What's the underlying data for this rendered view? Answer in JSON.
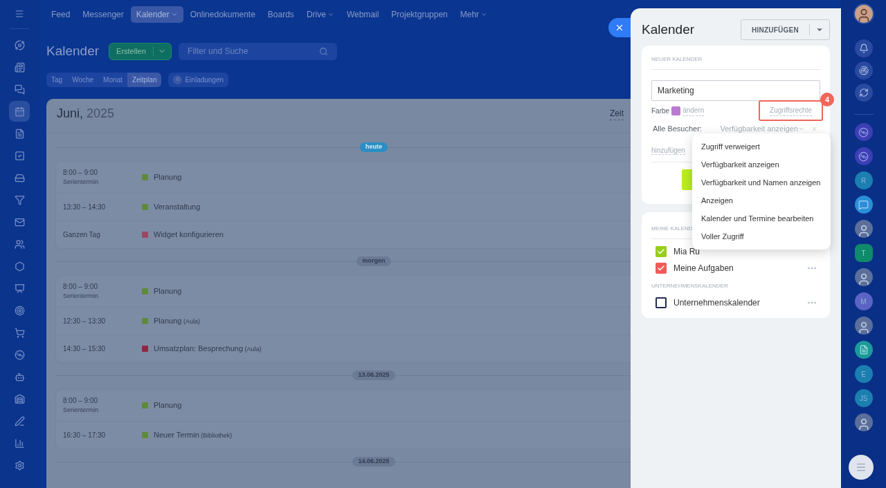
{
  "nav": {
    "items": [
      {
        "label": "Feed",
        "selected": false,
        "caret": false
      },
      {
        "label": "Messenger",
        "selected": false,
        "caret": false
      },
      {
        "label": "Kalender",
        "selected": true,
        "caret": true
      },
      {
        "label": "Onlinedokumente",
        "selected": false,
        "caret": false
      },
      {
        "label": "Boards",
        "selected": false,
        "caret": false
      },
      {
        "label": "Drive",
        "selected": false,
        "caret": true
      },
      {
        "label": "Webmail",
        "selected": false,
        "caret": false
      },
      {
        "label": "Projektgruppen",
        "selected": false,
        "caret": false
      },
      {
        "label": "Mehr",
        "selected": false,
        "caret": true
      }
    ]
  },
  "page": {
    "title": "Kalender",
    "create_button": "Erstellen",
    "search": {
      "placeholder": "Filter und Suche"
    },
    "view_tabs": [
      {
        "label": "Tag",
        "selected": false
      },
      {
        "label": "Woche",
        "selected": false
      },
      {
        "label": "Monat",
        "selected": false
      },
      {
        "label": "Zeitplan",
        "selected": true
      }
    ],
    "invitations": {
      "count": "0",
      "label": "Einladungen"
    }
  },
  "schedule": {
    "month": "Juni,",
    "year": "2025",
    "column_cut": "Zeit",
    "days": [
      {
        "label": "heute",
        "today": true,
        "events": [
          {
            "time": "8:00 – 9:00",
            "note": "Serientermin",
            "title": "Planung",
            "color": "#5e8a3c"
          },
          {
            "time": "13:30 – 14:30",
            "title": "Veranstaltung",
            "color": "#5e8a3c"
          },
          {
            "time": "Ganzen Tag",
            "title": "Widget konfigurieren",
            "color": "#9a4a60"
          }
        ]
      },
      {
        "label": "morgen",
        "today": false,
        "events": [
          {
            "time": "8:00 – 9:00",
            "note": "Serientermin",
            "title": "Planung",
            "color": "#5e8a3c"
          },
          {
            "time": "12:30 – 13:30",
            "title": "Planung",
            "location": "(Aula)",
            "color": "#5e8a3c"
          },
          {
            "time": "14:30 – 15:30",
            "title": "Umsatzplan: Besprechung",
            "location": "(Aula)",
            "color": "#8a2a40"
          }
        ]
      },
      {
        "label": "13.06.2025",
        "today": false,
        "events": [
          {
            "time": "8:00 – 9:00",
            "note": "Serientermin",
            "title": "Planung",
            "color": "#5e8a3c"
          },
          {
            "time": "16:30 – 17:30",
            "title": "Neuer Termin",
            "location": "(Bibliothek)",
            "color": "#5e8a3c"
          }
        ]
      },
      {
        "label": "14.06.2025",
        "today": false
      }
    ]
  },
  "panel": {
    "title": "Kalender",
    "add_button": "HINZUFÜGEN",
    "new_calendar": {
      "section_label": "NEUER KALENDER",
      "name_value": "Marketing",
      "color_label": "Farbe",
      "color": "#b97ad0",
      "change_link": "ändern",
      "access_link": "Zugriffsrechte",
      "step_badge": "4",
      "access_row": {
        "label": "Alle Besucher:",
        "value": "Verfügbarkeit anzeigen"
      },
      "add_link": "hinzufügen"
    },
    "access_menu": [
      "Zugriff verweigert",
      "Verfügbarkeit anzeigen",
      "Verfügbarkeit und Namen anzeigen",
      "Anzeigen",
      "Kalender und Termine bearbeiten",
      "Voller Zugriff"
    ],
    "my_calendars": {
      "section_label": "MEINE KALEND",
      "items": [
        {
          "label": "Mia Ru",
          "checked": true,
          "color": "#9acd1a",
          "more": false
        },
        {
          "label": "Meine Aufgaben",
          "checked": true,
          "color": "#f25a5a",
          "more": true
        }
      ]
    },
    "company_calendars": {
      "section_label": "UNTERNEHMENSKALENDER",
      "items": [
        {
          "label": "Unternehmenskalender",
          "checked": false,
          "color": "#1f2d4d",
          "more": true
        }
      ]
    }
  },
  "rail": {
    "contacts": [
      {
        "kind": "swirl"
      },
      {
        "kind": "swirl"
      },
      {
        "kind": "letter",
        "initials": "R",
        "color": "#1b7fb0"
      },
      {
        "kind": "chat"
      },
      {
        "kind": "photo"
      },
      {
        "kind": "hex",
        "initials": "T",
        "color": "#0f8a6a"
      },
      {
        "kind": "photo"
      },
      {
        "kind": "letter",
        "initials": "M",
        "color": "#5b63c4"
      },
      {
        "kind": "photo"
      },
      {
        "kind": "square"
      },
      {
        "kind": "letter",
        "initials": "E",
        "color": "#1b7fb0"
      },
      {
        "kind": "letter",
        "initials": "JS",
        "color": "#1b7fb0"
      },
      {
        "kind": "photo"
      }
    ]
  }
}
